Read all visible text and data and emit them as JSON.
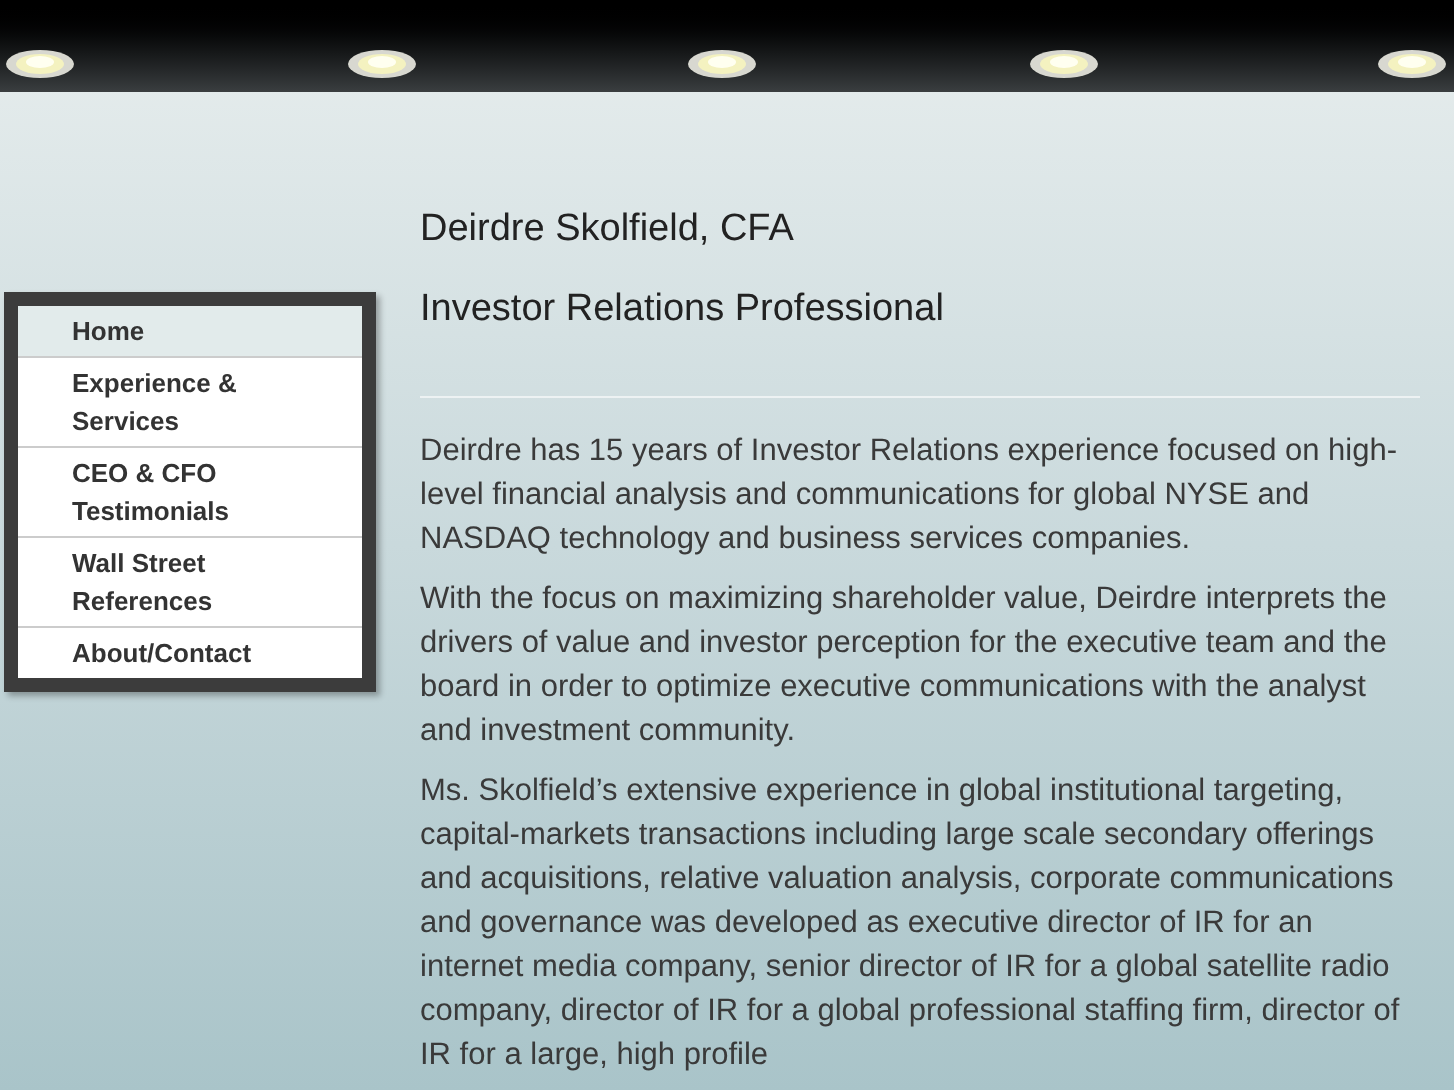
{
  "nav": [
    {
      "label": "Home",
      "selected": true
    },
    {
      "label": "Experience & Services",
      "selected": false
    },
    {
      "label": "CEO & CFO Testimonials",
      "selected": false
    },
    {
      "label": "Wall Street References",
      "selected": false
    },
    {
      "label": "About/Contact",
      "selected": false
    }
  ],
  "name": "Deirdre Skolfield, CFA",
  "subtitle": "Investor Relations Professional",
  "paragraphs": [
    "Deirdre has 15 years of Investor Relations experience focused on high-level financial analysis and communications for global NYSE and NASDAQ technology and business services companies.",
    "With the focus on maximizing shareholder value, Deirdre interprets the drivers of value and investor perception for the executive team and the board in order to optimize executive communications with the analyst and investment community.",
    "Ms. Skolfield’s extensive experience in global institutional targeting, capital-markets transactions including large scale secondary offerings and acquisitions, relative valuation analysis, corporate communications and governance was developed as executive director of IR for an internet media company, senior director of IR for a global satellite radio company, director of IR for a global professional staffing firm, director of IR for a large, high profile"
  ]
}
